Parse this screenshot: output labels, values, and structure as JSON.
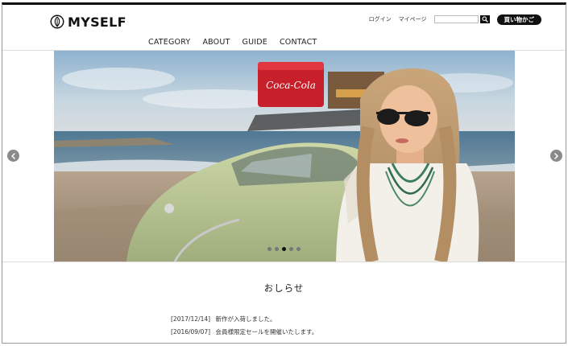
{
  "brand": {
    "name": "MYSELF",
    "logo_icon": "leaf-emblem-icon"
  },
  "header": {
    "util_links": [
      {
        "label": "ログイン"
      },
      {
        "label": "マイページ"
      }
    ],
    "search": {
      "placeholder": "",
      "value": "",
      "button_icon": "search-icon"
    },
    "cart_label": "買い物かご"
  },
  "nav": {
    "items": [
      {
        "label": "CATEGORY"
      },
      {
        "label": "ABOUT"
      },
      {
        "label": "GUIDE"
      },
      {
        "label": "CONTACT"
      }
    ]
  },
  "slider": {
    "prev_icon": "chevron-left-icon",
    "next_icon": "chevron-right-icon",
    "slide_count": 5,
    "active_index": 2,
    "cooler_brand": "Coca-Cola"
  },
  "news": {
    "title": "おしらせ",
    "items": [
      {
        "date": "[2017/12/14]",
        "text": "新作が入荷しました。"
      },
      {
        "date": "[2016/09/07]",
        "text": "会員様限定セールを開催いたします。"
      }
    ]
  },
  "colors": {
    "text": "#222222",
    "button_dark": "#111111",
    "arrow_bg": "#8a8a8a",
    "divider": "#dcdcdc"
  }
}
